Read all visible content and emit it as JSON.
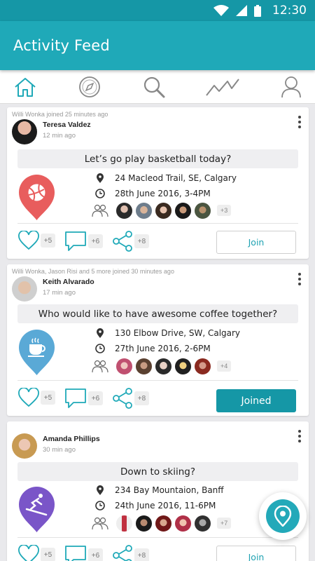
{
  "status_bar": {
    "time": "12:30"
  },
  "app_bar": {
    "title": "Activity Feed"
  },
  "tabs": [
    {
      "name": "home",
      "icon": "home-icon",
      "active": true
    },
    {
      "name": "explore",
      "icon": "compass-icon",
      "active": false
    },
    {
      "name": "search",
      "icon": "search-icon",
      "active": false
    },
    {
      "name": "activity",
      "icon": "activity-chart-icon",
      "active": false
    },
    {
      "name": "profile",
      "icon": "person-icon",
      "active": false
    }
  ],
  "colors": {
    "primary": "#1fa9b8",
    "status": "#1597a6",
    "accent_red": "#e85d5d",
    "accent_blue": "#5aa9d6",
    "accent_purple": "#7a55c8"
  },
  "cards": [
    {
      "joined_by": "Willi Wonka joined 25 minutes ago",
      "user": "Teresa Valdez",
      "time": "12 min ago",
      "question": "Let’s go play basketball today?",
      "category_icon": "basketball-icon",
      "location": "24 Macleod Trail, SE, Calgary",
      "datetime": "28th June 2016, 3-4PM",
      "more_people": "+3",
      "likes": "+5",
      "comments": "+6",
      "shares": "+8",
      "join_label": "Join",
      "joined": false
    },
    {
      "joined_by": "Willi Wonka, Jason Risi and 5 more  joined 30 minutes ago",
      "user": "Keith Alvarado",
      "time": "17 min ago",
      "question": "Who would like to have awesome coffee together?",
      "category_icon": "coffee-cup-icon",
      "location": "130 Elbow Drive, SW, Calgary",
      "datetime": "27th June 2016, 2-6PM",
      "more_people": "+4",
      "likes": "+5",
      "comments": "+6",
      "shares": "+8",
      "join_label": "Joined",
      "joined": true
    },
    {
      "joined_by": "",
      "user": "Amanda Phillips",
      "time": "30 min ago",
      "question": "Down to skiing?",
      "category_icon": "skiing-icon",
      "location": "234 Bay Mountaion, Banff",
      "datetime": "24th June 2016, 11-6PM",
      "more_people": "+7",
      "likes": "+5",
      "comments": "+6",
      "shares": "+8",
      "join_label": "Join",
      "joined": false
    }
  ]
}
